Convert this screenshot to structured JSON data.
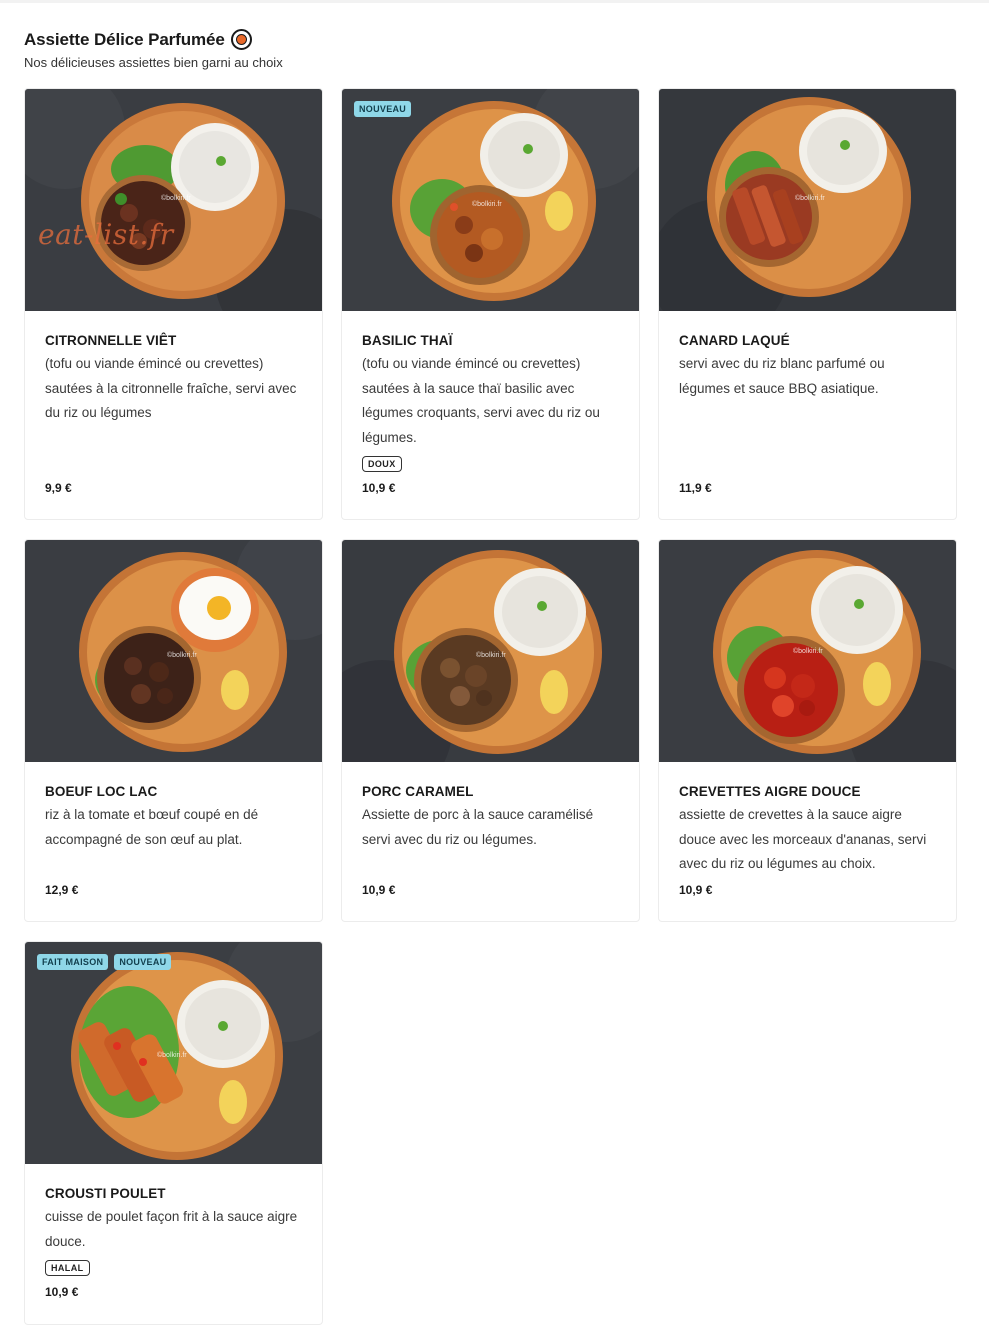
{
  "section": {
    "title": "Assiette Délice Parfumée",
    "subtitle": "Nos délicieuses assiettes bien garni au choix"
  },
  "watermark": "eat-list.fr",
  "photo_credit": "©bolkiri.fr",
  "colors": {
    "badge_bg": "#8fd7e8",
    "icon_accent": "#e8692a",
    "watermark": "#e86e3c"
  },
  "items": [
    {
      "name": "CITRONNELLE VIÊT",
      "description": "(tofu ou viande émincé ou crevettes) sautées à la citronnelle fraîche, servi avec du riz ou légumes",
      "price": "9,9 €",
      "badges": [],
      "tag": "",
      "image": "plate-lemongrass-beef"
    },
    {
      "name": "BASILIC THAÏ",
      "description": "(tofu ou viande émincé ou crevettes) sautées à la sauce thaï basilic avec légumes croquants, servi avec du riz ou légumes.",
      "price": "10,9 €",
      "badges": [
        "NOUVEAU"
      ],
      "tag": "DOUX",
      "image": "plate-thai-basil"
    },
    {
      "name": "CANARD LAQUÉ",
      "description": "servi avec du riz blanc parfumé ou légumes et sauce BBQ asiatique.",
      "price": "11,9 €",
      "badges": [],
      "tag": "",
      "image": "plate-lacquered-duck"
    },
    {
      "name": "BOEUF LOC LAC",
      "description": "riz à la tomate et bœuf coupé en dé accompagné de son œuf au plat.",
      "price": "12,9 €",
      "badges": [],
      "tag": "",
      "image": "plate-beef-loc-lac"
    },
    {
      "name": "PORC CARAMEL",
      "description": "Assiette de porc à la sauce caramélisé servi avec du riz ou légumes.",
      "price": "10,9 €",
      "badges": [],
      "tag": "",
      "image": "plate-caramel-pork"
    },
    {
      "name": "CREVETTES AIGRE DOUCE",
      "description": "assiette de crevettes à la sauce aigre douce avec les morceaux d'ananas, servi avec du riz ou légumes au choix.",
      "price": "10,9 €",
      "badges": [],
      "tag": "",
      "image": "plate-sweet-sour-shrimp"
    },
    {
      "name": "CROUSTI POULET",
      "description": "cuisse de poulet façon frit à la sauce aigre douce.",
      "price": "10,9 €",
      "badges": [
        "FAIT MAISON",
        "NOUVEAU"
      ],
      "tag": "HALAL",
      "image": "plate-crispy-chicken"
    }
  ]
}
